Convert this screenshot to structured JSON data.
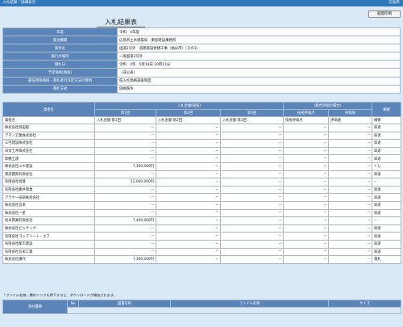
{
  "topbar": {
    "left": "入札結果／詳細表示",
    "right": "広島県"
  },
  "print_button": "画面印刷",
  "title": "入札結果表",
  "info": [
    {
      "label": "年度",
      "value": "令和　4年度"
    },
    {
      "label": "発注機関",
      "value": "広島県土木建築局　東部建設事務所"
    },
    {
      "label": "案件名",
      "value": "国道2号外　道路施設修繕工事（福山市）（その1）"
    },
    {
      "label": "施行の場所",
      "value": "一般国道2号外"
    },
    {
      "label": "開札日",
      "value": "令和　4年　5月18日 10時11分"
    },
    {
      "label": "予定価格(税抜)",
      "value": "（非公表）"
    },
    {
      "label": "最低制限価格・落札者の決定方法の特例",
      "value": "低入札価格調査制度"
    },
    {
      "label": "落札方式",
      "value": "価格競争"
    }
  ],
  "results": {
    "headers": {
      "company": "業者名",
      "bid_group": "入札金額(税抜)",
      "eval_group": "(総合評価の場合)",
      "remarks": "摘要",
      "round1": "第1回",
      "round2": "第2回",
      "round3": "第3回",
      "tech_score": "技術評価点",
      "eval_value": "評価値"
    },
    "subheader": [
      "業者名",
      "入札金額 第1回",
      "入札金額 第2回",
      "入札金額 第3回",
      "技術評価点",
      "評価値",
      "摘要"
    ],
    "rows": [
      {
        "company": "株式会社岡田組",
        "r1": "--",
        "r2": "--",
        "r3": "--",
        "tech": "--",
        "val": "--",
        "remark": "辞退"
      },
      {
        "company": "アマノ工業株式会社",
        "r1": "--",
        "r2": "--",
        "r3": "--",
        "tech": "--",
        "val": "--",
        "remark": "辞退"
      },
      {
        "company": "三宅建設株式会社",
        "r1": "--",
        "r2": "--",
        "r3": "--",
        "tech": "--",
        "val": "--",
        "remark": "辞退"
      },
      {
        "company": "日栄土木株式会社",
        "r1": "--",
        "r2": "--",
        "r3": "--",
        "tech": "--",
        "val": "--",
        "remark": "辞退"
      },
      {
        "company": "新鶴土建",
        "r1": "--",
        "r2": "--",
        "r3": "--",
        "tech": "--",
        "val": "--",
        "remark": "辞退"
      },
      {
        "company": "株式会社ユキ建設",
        "r1": "7,300,000円",
        "r2": "--",
        "r3": "--",
        "tech": "--",
        "val": "--",
        "remark": "くじ"
      },
      {
        "company": "東部開発有限会社",
        "r1": "--",
        "r2": "--",
        "r3": "--",
        "tech": "--",
        "val": "--",
        "remark": "辞退"
      },
      {
        "company": "有限会社高雄",
        "r1": "12,000,000円",
        "r2": "--",
        "r3": "--",
        "tech": "--",
        "val": "--",
        "remark": "--"
      },
      {
        "company": "有限会社藤井興業",
        "r1": "--",
        "r2": "--",
        "r3": "--",
        "tech": "--",
        "val": "--",
        "remark": "辞退"
      },
      {
        "company": "アラヤ一技研株式会社",
        "r1": "--",
        "r2": "--",
        "r3": "--",
        "tech": "--",
        "val": "--",
        "remark": "辞退"
      },
      {
        "company": "株式会社宮本",
        "r1": "--",
        "r2": "--",
        "r3": "--",
        "tech": "--",
        "val": "--",
        "remark": "辞退"
      },
      {
        "company": "株式会社一星",
        "r1": "--",
        "r2": "--",
        "r3": "--",
        "tech": "--",
        "val": "--",
        "remark": "辞退"
      },
      {
        "company": "松永興業有限会社",
        "r1": "7,400,000円",
        "r2": "--",
        "r3": "--",
        "tech": "--",
        "val": "--",
        "remark": "--"
      },
      {
        "company": "株式会社ビルテック",
        "r1": "--",
        "r2": "--",
        "r3": "--",
        "tech": "--",
        "val": "--",
        "remark": "辞退"
      },
      {
        "company": "有限会社コンプリート・エフ",
        "r1": "--",
        "r2": "--",
        "r3": "--",
        "tech": "--",
        "val": "--",
        "remark": "辞退"
      },
      {
        "company": "有限会社都市建設",
        "r1": "--",
        "r2": "--",
        "r3": "--",
        "tech": "--",
        "val": "--",
        "remark": "辞退"
      },
      {
        "company": "有限会社功栄工業",
        "r1": "--",
        "r2": "--",
        "r3": "--",
        "tech": "--",
        "val": "--",
        "remark": "辞退"
      },
      {
        "company": "株式会社瀬代",
        "r1": "7,300,000円",
        "r2": "--",
        "r3": "--",
        "tech": "--",
        "val": "--",
        "remark": "落札"
      }
    ]
  },
  "note": "「ファイル名称」欄のリンクを押下すると、ダウンロードが開始されます。",
  "attachments": {
    "label": "添付書類",
    "headers": {
      "no": "No",
      "doc_name": "図書名称",
      "file_name": "ファイル名称",
      "size": "サイズ"
    }
  }
}
